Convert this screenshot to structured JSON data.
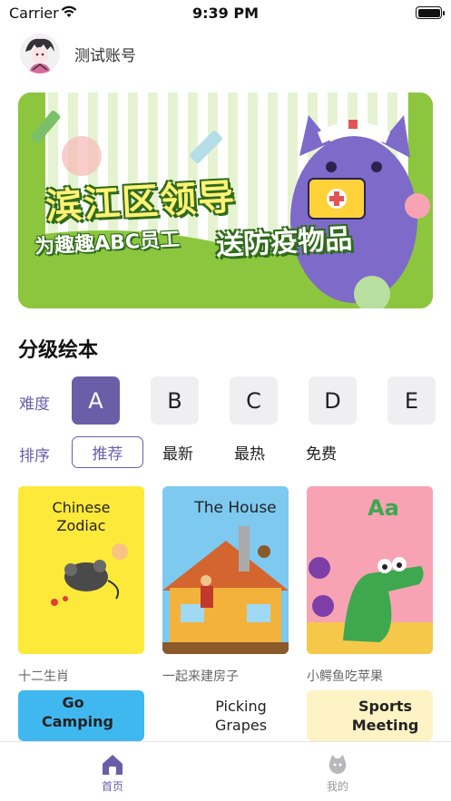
{
  "status_bar": {
    "carrier": "Carrier",
    "time": "9:39 PM"
  },
  "user": {
    "account_name": "测试账号"
  },
  "banner": {
    "line1": "滨江区领导",
    "line2": "为趣趣ABC员工",
    "line3": "送防疫物品"
  },
  "section": {
    "title": "分级绘本"
  },
  "filters": {
    "level_label": "难度",
    "levels": [
      "A",
      "B",
      "C",
      "D",
      "E"
    ],
    "selected_level": "A",
    "sort_label": "排序",
    "sorts": [
      "推荐",
      "最新",
      "最热",
      "免费"
    ],
    "selected_sort": "推荐"
  },
  "books": [
    {
      "cover_title_1": "Chinese",
      "cover_title_2": "Zodiac",
      "caption": "十二生肖",
      "bg": "#fde93a"
    },
    {
      "cover_title_1": "The House",
      "cover_title_2": "",
      "caption": "一起来建房子",
      "bg": "#7ec9ef"
    },
    {
      "cover_title_1": "Aa",
      "cover_title_2": "",
      "caption": "小鳄鱼吃苹果",
      "bg": "#f7a3b3"
    },
    {
      "cover_title_1": "Go",
      "cover_title_2": "Camping",
      "caption": "",
      "bg": "#3fb8f0"
    },
    {
      "cover_title_1": "Picking",
      "cover_title_2": "Grapes",
      "caption": "",
      "bg": "#ffffff"
    },
    {
      "cover_title_1": "Sports",
      "cover_title_2": "Meeting",
      "caption": "",
      "bg": "#fdf3c4"
    }
  ],
  "tabs": [
    {
      "label": "首页",
      "icon": "home-icon",
      "active": true
    },
    {
      "label": "我的",
      "icon": "profile-icon",
      "active": false
    }
  ],
  "colors": {
    "accent": "#6b5ea8",
    "level_inactive_bg": "#efeff1"
  }
}
